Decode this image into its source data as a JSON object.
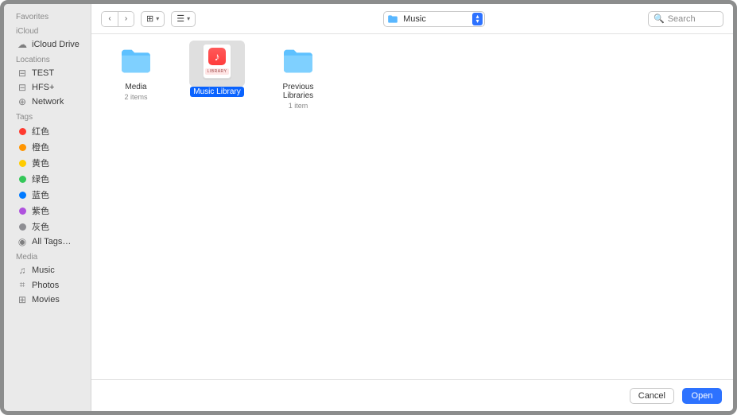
{
  "toolbar": {
    "back_label": "‹",
    "forward_label": "›",
    "view_icon_label": "⊞",
    "group_icon_label": "☰",
    "path_folder": "Music",
    "search_placeholder": "Search"
  },
  "sidebar": {
    "favorites_heading": "Favorites",
    "icloud_heading": "iCloud",
    "icloud_drive": "iCloud Drive",
    "locations_heading": "Locations",
    "loc_test": "TEST",
    "loc_hfs": "HFS+",
    "loc_network": "Network",
    "tags_heading": "Tags",
    "tag_red": "红色",
    "tag_orange": "橙色",
    "tag_yellow": "黄色",
    "tag_green": "绿色",
    "tag_blue": "蓝色",
    "tag_purple": "紫色",
    "tag_gray": "灰色",
    "all_tags": "All Tags…",
    "media_heading": "Media",
    "media_music": "Music",
    "media_photos": "Photos",
    "media_movies": "Movies"
  },
  "items": {
    "media": {
      "name": "Media",
      "sub": "2 items"
    },
    "library": {
      "name": "Music Library",
      "sub": ""
    },
    "previous": {
      "name": "Previous Libraries",
      "sub": "1 item"
    }
  },
  "library_thumb_label": "LIBRARY",
  "footer": {
    "cancel": "Cancel",
    "open": "Open"
  }
}
